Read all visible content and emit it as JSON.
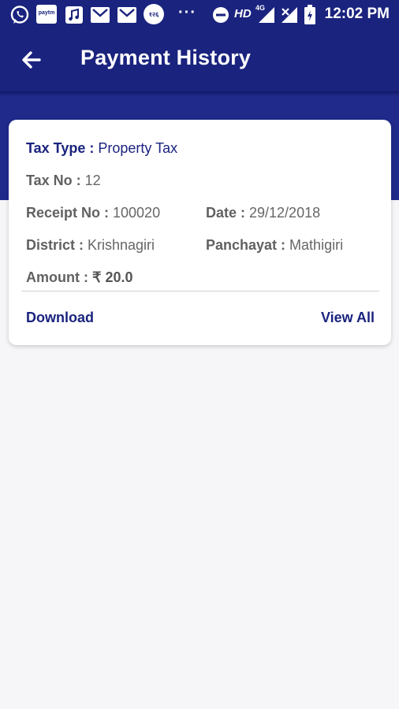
{
  "status_bar": {
    "time": "12:02 PM",
    "left_icons": [
      "whatsapp-icon",
      "paytm-icon",
      "music-icon",
      "gmail-icon",
      "gmail-icon",
      "app-icon",
      "more-icon"
    ],
    "right_icons": [
      "dnd-icon",
      "hd-icon",
      "signal-4g-icon",
      "signal-icon",
      "battery-icon"
    ],
    "hd_label": "HD",
    "net_label": "4G",
    "paytm_label": "paytm",
    "app_badge_label": "१२६",
    "more_label": "···"
  },
  "app_bar": {
    "title": "Payment History",
    "back_icon": "arrow-left-icon"
  },
  "card": {
    "tax_type_label": "Tax Type : ",
    "tax_type_value": "Property Tax",
    "tax_no_label": "Tax No : ",
    "tax_no_value": "12",
    "receipt_no_label": "Receipt No : ",
    "receipt_no_value": "100020",
    "date_label": "Date : ",
    "date_value": "29/12/2018",
    "district_label": "District : ",
    "district_value": "Krishnagiri",
    "panchayat_label": "Panchayat : ",
    "panchayat_value": "Mathigiri",
    "amount_label": "Amount : ",
    "amount_value": "₹ 20.0",
    "download_label": "Download",
    "view_all_label": "View All"
  },
  "colors": {
    "primary": "#1a237e",
    "background": "#f6f6f8",
    "card": "#ffffff"
  }
}
